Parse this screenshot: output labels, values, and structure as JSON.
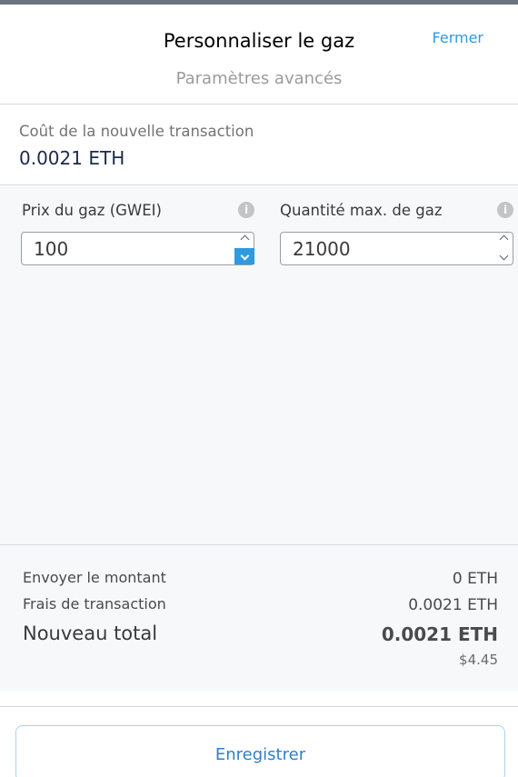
{
  "header": {
    "title": "Personnaliser le gaz",
    "subtitle": "Paramètres avancés",
    "close_label": "Fermer"
  },
  "cost": {
    "label": "Coût de la nouvelle transaction",
    "value": "0.0021 ETH"
  },
  "gas_price": {
    "label": "Prix du gaz (GWEI)",
    "value": "100",
    "info_icon": "i"
  },
  "gas_limit": {
    "label": "Quantité max. de gaz",
    "value": "21000",
    "info_icon": "i"
  },
  "totals": {
    "send_amount_label": "Envoyer le montant",
    "send_amount_value": "0 ETH",
    "fee_label": "Frais de transaction",
    "fee_value": "0.0021 ETH",
    "total_label": "Nouveau total",
    "total_value": "0.0021 ETH",
    "total_fiat": "$4.45"
  },
  "footer": {
    "save_label": "Enregistrer"
  },
  "colors": {
    "accent": "#2f9ae0",
    "panel_bg": "#f7f8fa",
    "border": "#d6d9dc"
  }
}
